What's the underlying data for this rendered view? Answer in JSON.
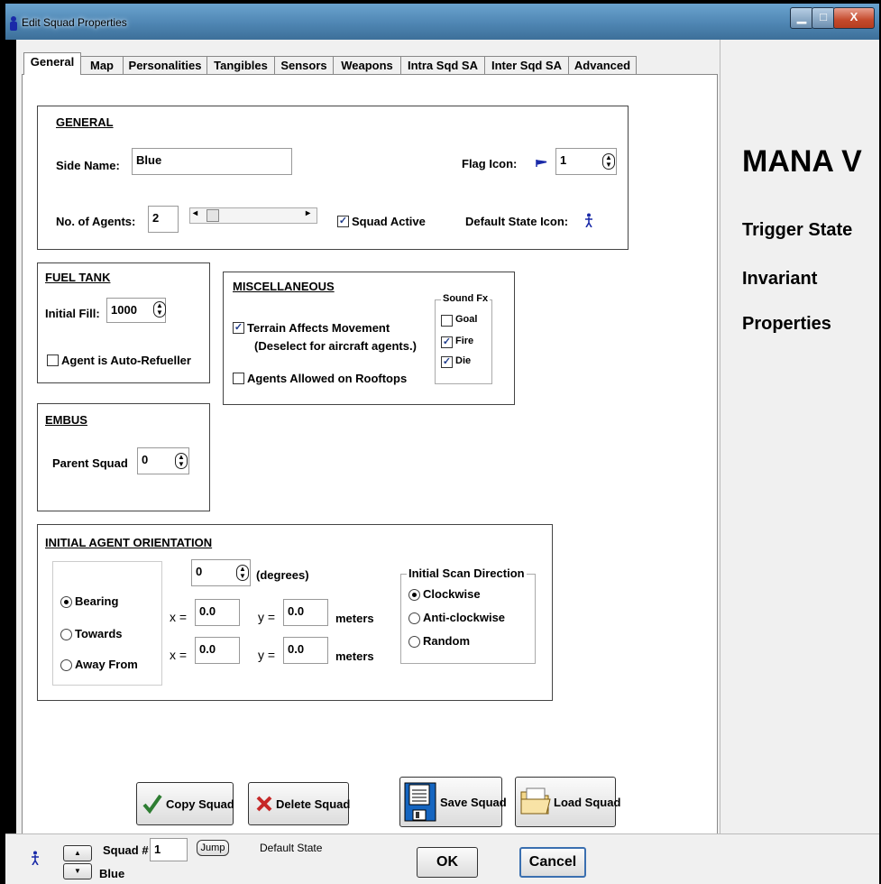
{
  "window": {
    "title": "Edit Squad Properties"
  },
  "tabs": [
    "General",
    "Map",
    "Personalities",
    "Tangibles",
    "Sensors",
    "Weapons",
    "Intra Sqd SA",
    "Inter Sqd SA",
    "Advanced"
  ],
  "general": {
    "title": "GENERAL",
    "side_name_label": "Side Name:",
    "side_name_value": "Blue",
    "flag_icon_label": "Flag Icon:",
    "flag_icon_value": "1",
    "agents_label": "No. of Agents:",
    "agents_value": "2",
    "squad_active_label": "Squad Active",
    "default_state_icon_label": "Default State Icon:"
  },
  "fuel": {
    "title": "FUEL TANK",
    "initial_fill_label": "Initial Fill:",
    "initial_fill_value": "1000",
    "auto_refueller_label": "Agent is Auto-Refueller"
  },
  "misc": {
    "title": "MISCELLANEOUS",
    "terrain_label": "Terrain Affects Movement",
    "terrain_note": "(Deselect for aircraft agents.)",
    "rooftops_label": "Agents Allowed on Rooftops",
    "sound_fx_title": "Sound Fx",
    "sound_goal": "Goal",
    "sound_fire": "Fire",
    "sound_die": "Die"
  },
  "embus": {
    "title": "EMBUS",
    "parent_label": "Parent Squad",
    "parent_value": "0"
  },
  "orientation": {
    "title": "INITIAL AGENT ORIENTATION",
    "bearing": "Bearing",
    "towards": "Towards",
    "away_from": "Away From",
    "degrees_value": "0",
    "degrees_label": "(degrees)",
    "x_label": "x =",
    "y_label": "y =",
    "towards_x": "0.0",
    "towards_y": "0.0",
    "away_x": "0.0",
    "away_y": "0.0",
    "meters": "meters",
    "scan_title": "Initial Scan Direction",
    "clockwise": "Clockwise",
    "anticlockwise": "Anti-clockwise",
    "random": "Random"
  },
  "actions": {
    "copy": "Copy Squad",
    "delete": "Delete Squad",
    "save": "Save Squad",
    "load": "Load Squad"
  },
  "right_panel": {
    "title": "MANA V",
    "line1": "Trigger State",
    "line2": "Invariant",
    "line3": "Properties"
  },
  "footer": {
    "squad_label": "Squad #",
    "squad_value": "1",
    "jump": "Jump",
    "state": "Default State",
    "side": "Blue",
    "ok": "OK",
    "cancel": "Cancel"
  },
  "colors": {
    "accent": "#1a237e",
    "title_bar": "#4f86b3",
    "close": "#c44a2c"
  }
}
